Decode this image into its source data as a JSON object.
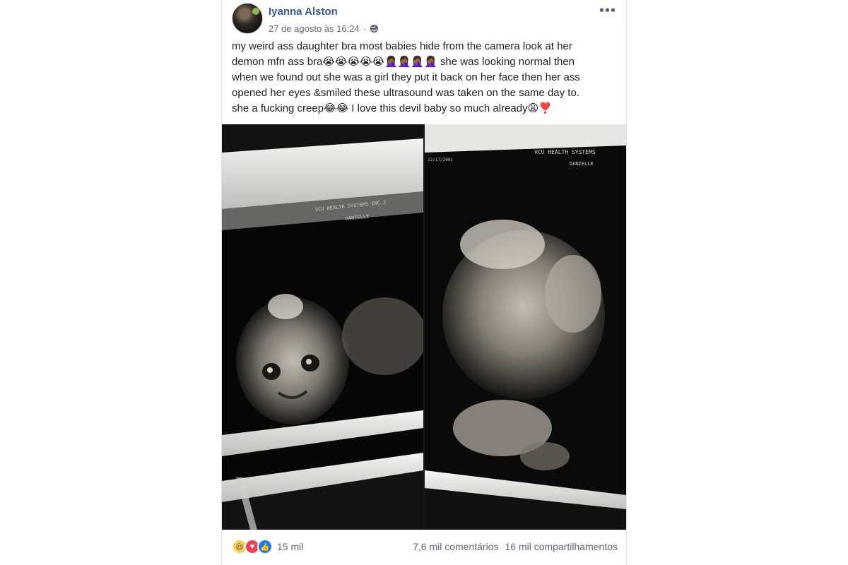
{
  "post": {
    "author": "Iyanna Alston",
    "timestamp": "27 de agosto às 16:24",
    "separator": "·",
    "privacy_icon": "globe-icon",
    "more_icon": "•••",
    "text_lines": [
      "my weird ass daughter bra most babies hide from the camera look at her",
      "demon mfn ass bra😭😭😭😭😭🤦🏾‍♀️🤦🏾‍♀️🤦🏾‍♀️🤦🏾‍♀️ she was looking normal then",
      "when we found out she was a girl they put it back on her face then her ass",
      "opened her eyes &smiled these ultrasound was taken on the same day to.",
      "she a fucking creep😂😂 I love this devil baby so much already😩❣️"
    ],
    "photos": [
      {
        "name": "ultrasound-left",
        "overlay_lines": [
          "VCU HEALTH SYSTEMS INC 2",
          "DANIELLE"
        ]
      },
      {
        "name": "ultrasound-right",
        "overlay_lines": [
          "VCU HEALTH SYSTEMS",
          "DANIELLE",
          "12/17/2001"
        ]
      }
    ],
    "reactions": {
      "icons": [
        "haha",
        "love",
        "like"
      ],
      "count": "15 mil"
    },
    "comments": "7,6 mil comentários",
    "shares": "16 mil compartilhamentos"
  },
  "colors": {
    "author_link": "#385898",
    "meta_text": "#616770",
    "body_text": "#1c1e21",
    "like_blue": "#1877f2",
    "love_red": "#f33e58",
    "haha_yellow": "#fccf48"
  }
}
